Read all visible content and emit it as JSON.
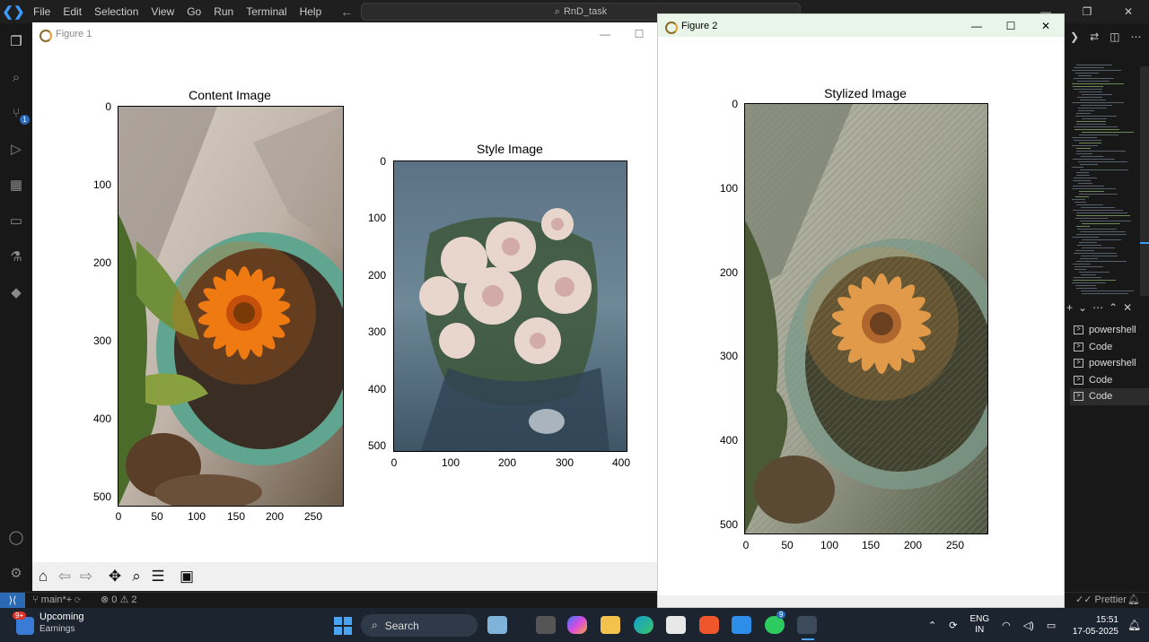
{
  "vscode": {
    "menu": [
      "File",
      "Edit",
      "Selection",
      "View",
      "Go",
      "Run",
      "Terminal",
      "Help"
    ],
    "command_center": "RnD_task",
    "status": {
      "branch": "main*+",
      "problems": "⊗ 0 ⚠ 2",
      "prettier": "Prettier"
    },
    "terminals": [
      "powershell",
      "Code",
      "powershell",
      "Code",
      "Code"
    ],
    "scm_badge": "1"
  },
  "figure1": {
    "window_title": "Figure 1",
    "content_title": "Content Image",
    "style_title": "Style Image",
    "content_y_ticks": [
      "0",
      "100",
      "200",
      "300",
      "400",
      "500"
    ],
    "content_x_ticks": [
      "0",
      "50",
      "100",
      "150",
      "200",
      "250"
    ],
    "style_y_ticks": [
      "0",
      "100",
      "200",
      "300",
      "400",
      "500"
    ],
    "style_x_ticks": [
      "0",
      "100",
      "200",
      "300",
      "400"
    ]
  },
  "figure2": {
    "window_title": "Figure 2",
    "stylized_title": "Stylized Image",
    "y_ticks": [
      "0",
      "100",
      "200",
      "300",
      "400",
      "500"
    ],
    "x_ticks": [
      "0",
      "50",
      "100",
      "150",
      "200",
      "250"
    ]
  },
  "taskbar": {
    "weather_title": "Upcoming",
    "weather_subtitle": "Earnings",
    "weather_badge": "9+",
    "search_label": "Search",
    "whatsapp_badge": "9",
    "lang_line1": "ENG",
    "lang_line2": "IN",
    "time": "15:51",
    "date": "17-05-2025"
  },
  "colors": {
    "vscode_bg": "#1f1f1f",
    "accent_blue": "#2b6bb5",
    "taskbar_bg": "#1c2430"
  }
}
